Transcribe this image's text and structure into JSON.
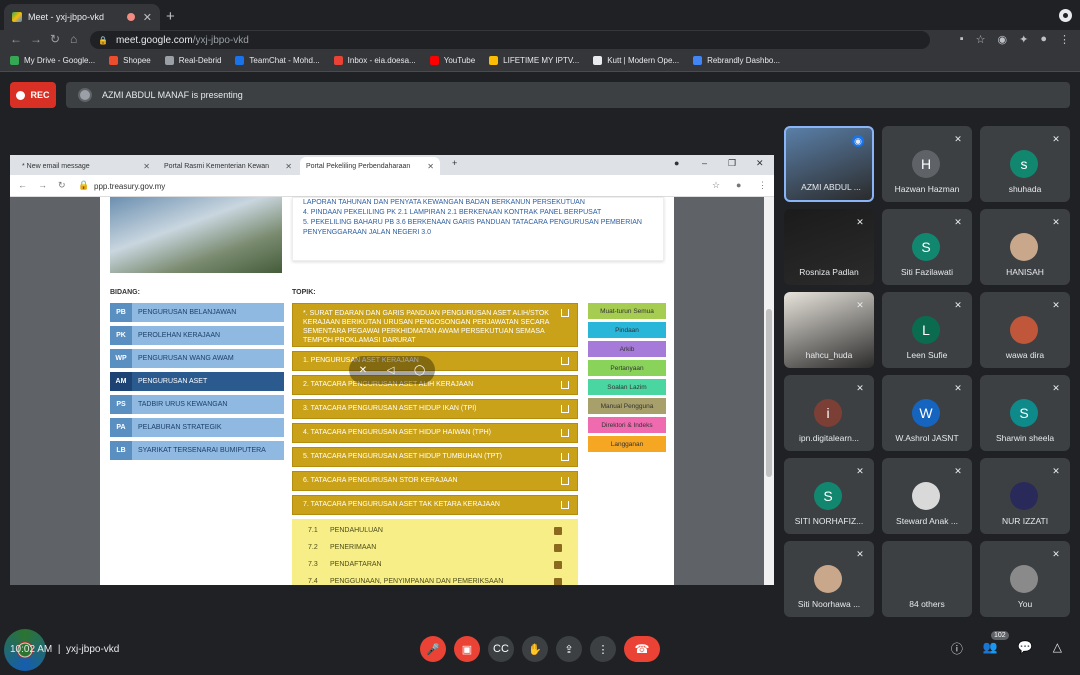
{
  "browser": {
    "tab_title": "Meet - yxj-jbpo-vkd",
    "url_domain": "meet.google.com",
    "url_path": "/yxj-jbpo-vkd",
    "bookmarks": [
      {
        "label": "My Drive - Google...",
        "color": "#34a853"
      },
      {
        "label": "Shopee",
        "color": "#ee4d2d"
      },
      {
        "label": "Real-Debrid",
        "color": "#9aa0a6"
      },
      {
        "label": "TeamChat - Mohd...",
        "color": "#1a73e8"
      },
      {
        "label": "Inbox - eia.doesa...",
        "color": "#ea4335"
      },
      {
        "label": "YouTube",
        "color": "#ff0000"
      },
      {
        "label": "LIFETIME MY IPTV...",
        "color": "#fbbc04"
      },
      {
        "label": "Kutt | Modern Ope...",
        "color": "#e8eaed"
      },
      {
        "label": "Rebrandly Dashbo...",
        "color": "#4285f4"
      }
    ]
  },
  "meet": {
    "rec_label": "REC",
    "presenting_text": "AZMI ABDUL MANAF is presenting",
    "time": "10:02 AM",
    "meeting_code": "yxj-jbpo-vkd",
    "people_count": "102"
  },
  "shared": {
    "tabs": [
      "* New email message",
      "Portal Rasmi Kementerian Kewan",
      "Portal Pekeliling Perbendaharaan"
    ],
    "url": "ppp.treasury.gov.my",
    "news": [
      "LAPORAN TAHUNAN DAN PENYATA KEWANGAN BADAN BERKANUN PERSEKUTUAN",
      "4. PINDAAN PEKELILING PK 2.1 LAMPIRAN 2.1 BERKENAAN KONTRAK PANEL BERPUSAT",
      "5. PEKELILING BAHARU PB 3.6 BERKENAAN GARIS PANDUAN TATACARA PENGURUSAN PEMBERIAN PENYENGGARAAN JALAN NEGERI 3.0"
    ],
    "bidang_label": "BIDANG:",
    "topik_label": "TOPIK:",
    "bidang": [
      {
        "ab": "PB",
        "tx": "PENGURUSAN BELANJAWAN"
      },
      {
        "ab": "PK",
        "tx": "PEROLEHAN KERAJAAN"
      },
      {
        "ab": "WP",
        "tx": "PENGURUSAN WANG AWAM"
      },
      {
        "ab": "AM",
        "tx": "PENGURUSAN ASET"
      },
      {
        "ab": "PS",
        "tx": "TADBIR URUS KEWANGAN"
      },
      {
        "ab": "PA",
        "tx": "PELABURAN STRATEGIK"
      },
      {
        "ab": "LB",
        "tx": "SYARIKAT TERSENARAI BUMIPUTERA"
      }
    ],
    "topik": [
      "*. SURAT EDARAN DAN GARIS PANDUAN PENGURUSAN ASET ALIH/STOK KERAJAAN BERIKUTAN URUSAN PENGOSONGAN PERJAWATAN SECARA SEMENTARA PEGAWAI PERKHIDMATAN AWAM PERSEKUTUAN SEMASA TEMPOH PROKLAMASI DARURAT",
      "1. PENGURUSAN ASET KERAJAAN",
      "2. TATACARA PENGURUSAN ASET ALIH KERAJAAN",
      "3. TATACARA PENGURUSAN ASET HIDUP IKAN (TPI)",
      "4. TATACARA PENGURUSAN ASET HIDUP HAIWAN (TPH)",
      "5. TATACARA PENGURUSAN ASET HIDUP TUMBUHAN (TPT)",
      "6. TATACARA PENGURUSAN STOR KERAJAAN",
      "7. TATACARA PENGURUSAN ASET TAK KETARA KERAJAAN"
    ],
    "sub": [
      {
        "n": "7.1",
        "t": "PENDAHULUAN"
      },
      {
        "n": "7.2",
        "t": "PENERIMAAN"
      },
      {
        "n": "7.3",
        "t": "PENDAFTARAN"
      },
      {
        "n": "7.4",
        "t": "PENGGUNAAN, PENYIMPANAN DAN PEMERIKSAAN"
      }
    ],
    "side": [
      {
        "t": "Muat-turun Semua",
        "c": "#a6cc52"
      },
      {
        "t": "Pindaan",
        "c": "#29b6d8"
      },
      {
        "t": "Arkib",
        "c": "#a57ad8"
      },
      {
        "t": "Pertanyaan",
        "c": "#8ad35a"
      },
      {
        "t": "Soalan Lazim",
        "c": "#49d6a0"
      },
      {
        "t": "Manual Pengguna",
        "c": "#a7a06a"
      },
      {
        "t": "Direktori & Indeks",
        "c": "#f06ab0"
      },
      {
        "t": "Langganan",
        "c": "#f5a623"
      }
    ]
  },
  "participants": [
    {
      "name": "AZMI ABDUL ...",
      "initial": "",
      "color": "#5a7fa8",
      "video": true
    },
    {
      "name": "Hazwan Hazman",
      "initial": "H",
      "color": "#5f6368"
    },
    {
      "name": "shuhada",
      "initial": "s",
      "color": "#12876f"
    },
    {
      "name": "Rosniza Padlan",
      "initial": "",
      "color": "#1b1b1b",
      "video": true
    },
    {
      "name": "Siti Fazilawati",
      "initial": "S",
      "color": "#12876f"
    },
    {
      "name": "HANISAH",
      "initial": "",
      "color": "#c9a78a"
    },
    {
      "name": "hahcu_huda",
      "initial": "",
      "color": "#e8e4dc",
      "video": true
    },
    {
      "name": "Leen Sufie",
      "initial": "L",
      "color": "#0b6b4f"
    },
    {
      "name": "wawa dira",
      "initial": "",
      "color": "#c0573a"
    },
    {
      "name": "ipn.digitalearn...",
      "initial": "i",
      "color": "#7b3f35"
    },
    {
      "name": "W.Ashrol JASNT",
      "initial": "W",
      "color": "#1565c0"
    },
    {
      "name": "Sharwin sheela",
      "initial": "S",
      "color": "#0e8a8a"
    },
    {
      "name": "SITI NORHAFIZ...",
      "initial": "S",
      "color": "#12876f"
    },
    {
      "name": "Steward Anak ...",
      "initial": "",
      "color": "#d9d9d9"
    },
    {
      "name": "NUR IZZATI",
      "initial": "",
      "color": "#2a2a5a"
    },
    {
      "name": "Siti Noorhawa ...",
      "initial": "",
      "color": "#c9a78a"
    },
    {
      "name": "84 others",
      "initial": "",
      "color": "#3c4043"
    },
    {
      "name": "You",
      "initial": "",
      "color": "#8a8a8a"
    }
  ]
}
